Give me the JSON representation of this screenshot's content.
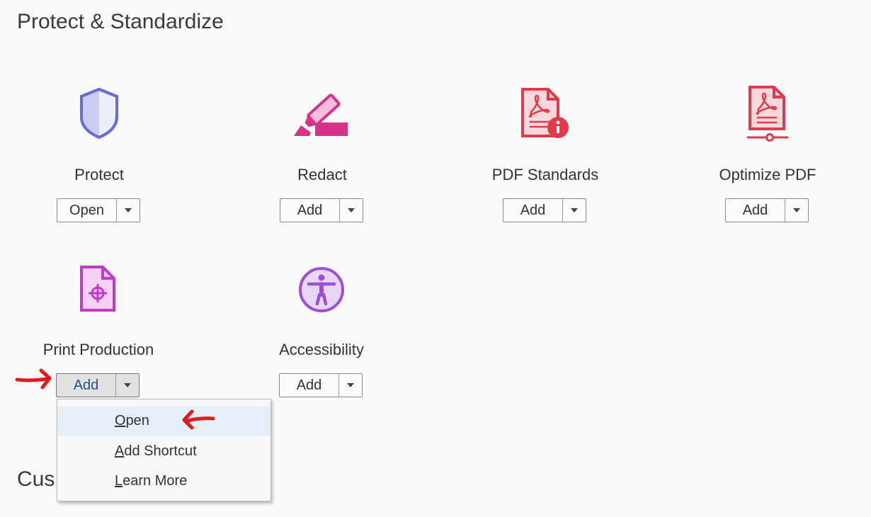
{
  "section": {
    "title": "Protect & Standardize",
    "next_title": "Cus"
  },
  "tools": [
    {
      "label": "Protect",
      "button": "Open",
      "icon": "shield-icon"
    },
    {
      "label": "Redact",
      "button": "Add",
      "icon": "redact-marker-icon"
    },
    {
      "label": "PDF Standards",
      "button": "Add",
      "icon": "pdf-standards-icon"
    },
    {
      "label": "Optimize PDF",
      "button": "Add",
      "icon": "optimize-pdf-icon"
    },
    {
      "label": "Print Production",
      "button": "Add",
      "icon": "print-production-icon"
    },
    {
      "label": "Accessibility",
      "button": "Add",
      "icon": "accessibility-icon"
    }
  ],
  "menu": {
    "items": [
      {
        "first": "O",
        "rest": "pen",
        "highlighted": true
      },
      {
        "first": "A",
        "rest": "dd Shortcut",
        "highlighted": false
      },
      {
        "first": "L",
        "rest": "earn More",
        "highlighted": false
      }
    ]
  },
  "colors": {
    "protect": "#6b6bd8",
    "redact": "#d8318a",
    "pdf_red": "#e03a4b",
    "print": "#c03ac7",
    "accessibility": "#9b4fd8",
    "annotation_red": "#e01b1b"
  }
}
